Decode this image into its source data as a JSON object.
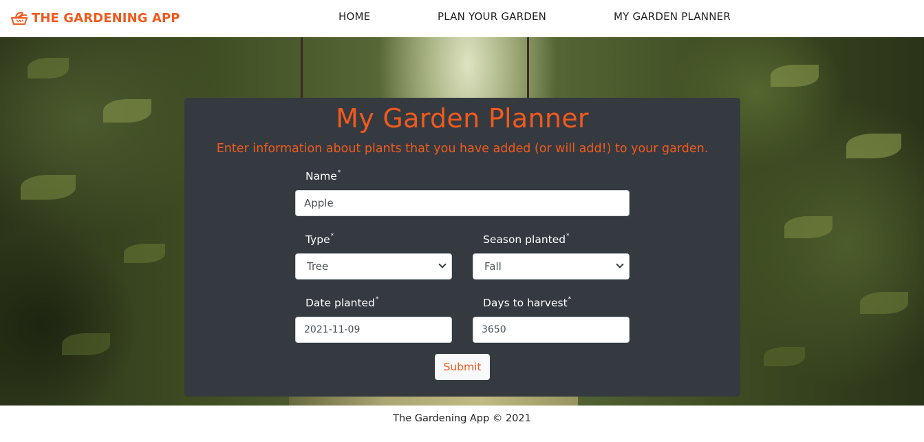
{
  "nav": {
    "brand": "THE GARDENING APP",
    "brand_icon": "leaf-basket-icon",
    "links": [
      "HOME",
      "PLAN YOUR GARDEN",
      "MY GARDEN PLANNER"
    ]
  },
  "form": {
    "title": "My Garden Planner",
    "subtitle": "Enter information about plants that you have added (or will add!) to your garden.",
    "name_label": "Name",
    "name_value": "Apple",
    "type_label": "Type",
    "type_value": "Tree",
    "season_label": "Season planted",
    "season_value": "Fall",
    "date_label": "Date planted",
    "date_value": "2021-11-09",
    "days_label": "Days to harvest",
    "days_value": "3650",
    "required_marker": "*",
    "submit_label": "Submit"
  },
  "footer": {
    "text": "The Gardening App © 2021"
  },
  "colors": {
    "accent": "#f05a1e",
    "panel": "#343a40"
  }
}
